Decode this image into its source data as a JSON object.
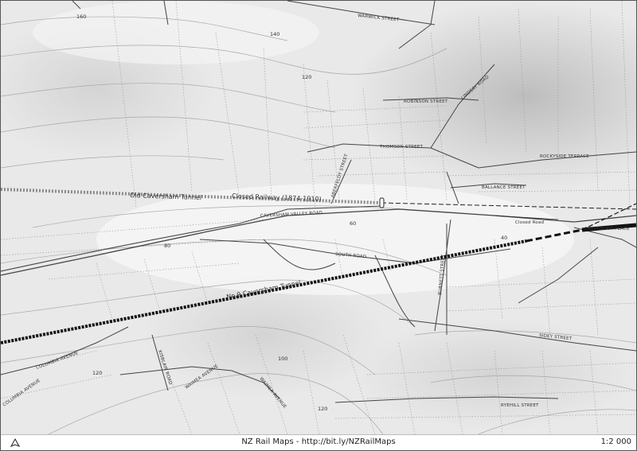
{
  "map": {
    "contour_labels": [
      "160",
      "140",
      "120",
      "80",
      "60",
      "40",
      "120",
      "100",
      "120"
    ],
    "street_labels": [
      "WARWICK STREET",
      "ROBINSON STREET",
      "LINDSAY ROAD",
      "THOMSON STREET",
      "ROCKYSIDE TERRACE",
      "ABERFELDY STREET",
      "BALLANCE STREET",
      "CAVERSHAM VALLEY ROAD",
      "CAVERSHAM PLACE",
      "SOUTH ROAD",
      "BURNETT STREET",
      "SIDEY STREET",
      "COLUMBIA AVENUE",
      "COLUMBIA AVENUE",
      "KISBLAIR ROAD",
      "WAIMEA AVENUE",
      "WAIMEA AVENUE",
      "RYEHILL STREET"
    ],
    "feature_labels": {
      "old_tunnel": "Old Caversham Tunnel",
      "closed_railway": "Closed Railway (1874-1910)",
      "closed_road": "Closed Road",
      "tunnel_no9": "No.9 Caversham Tunnel"
    },
    "colors": {
      "terrain_dark": "#c9c9c9",
      "terrain_light": "#f3f3f3",
      "road": "#444444",
      "parcel": "#9a9a9a",
      "railway_active": "#111111",
      "railway_closed": "#8a8a8a"
    }
  },
  "footer": {
    "attribution": "NZ Rail Maps - http://bit.ly/NZRailMaps",
    "scale": "1:2 000",
    "north_icon": "north-arrow-icon"
  }
}
